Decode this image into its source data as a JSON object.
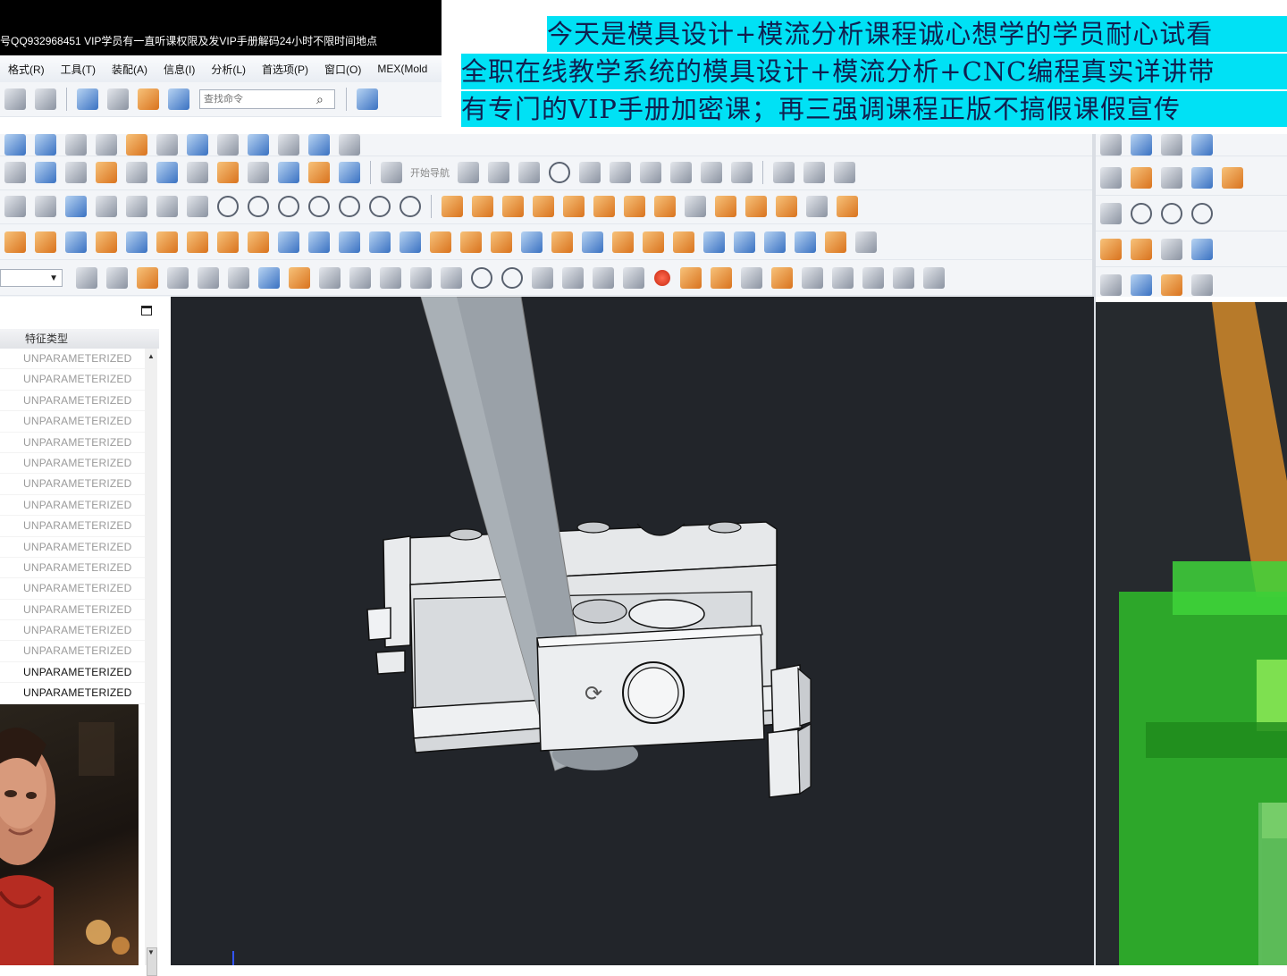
{
  "window": {
    "title": "号QQ932968451 VIP学员有一直听课权限及发VIP手册解码24小时不限时间地点"
  },
  "menu": {
    "items": [
      "格式(R)",
      "工具(T)",
      "装配(A)",
      "信息(I)",
      "分析(L)",
      "首选项(P)",
      "窗口(O)",
      "MEX(Mold"
    ]
  },
  "toolbar": {
    "search_placeholder": "查找命令",
    "filter_value": "",
    "label_dim": "开始导航"
  },
  "banner": {
    "line1": "今天是模具设计+模流分析课程诚心想学的学员耐心试看",
    "line2": "全职在线教学系统的模具设计+模流分析+CNC编程真实详讲带",
    "line3": "有专门的VIP手册加密课；再三强调课程正版不搞假课假宣传",
    "highlight_color": "#00e1f5"
  },
  "part_navigator": {
    "column_header": "特征类型",
    "rows": [
      "UNPARAMETERIZED",
      "UNPARAMETERIZED",
      "UNPARAMETERIZED",
      "UNPARAMETERIZED",
      "UNPARAMETERIZED",
      "UNPARAMETERIZED",
      "UNPARAMETERIZED",
      "UNPARAMETERIZED",
      "UNPARAMETERIZED",
      "UNPARAMETERIZED",
      "UNPARAMETERIZED",
      "UNPARAMETERIZED",
      "UNPARAMETERIZED",
      "UNPARAMETERIZED",
      "UNPARAMETERIZED",
      "UNPARAMETERIZED",
      "UNPARAMETERIZED"
    ]
  },
  "viewport": {
    "background": "#22252a",
    "part_color": "#eef0f2",
    "pin_color": "#9aa1a8"
  },
  "viewport_right": {
    "mold_color": "#3fd43a",
    "pin_color": "#b77a2a"
  }
}
